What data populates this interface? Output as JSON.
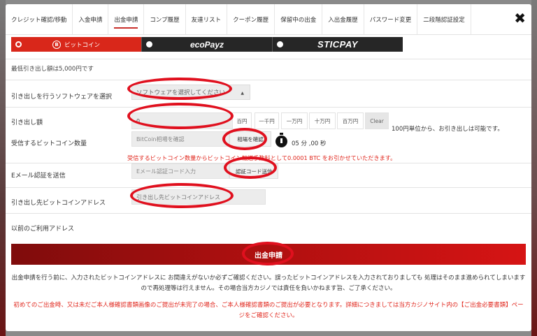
{
  "tabs": [
    {
      "label": "クレジット確認/移動"
    },
    {
      "label": "入金申請"
    },
    {
      "label": "出金申請",
      "active": true
    },
    {
      "label": "コンプ履歴"
    },
    {
      "label": "友達リスト"
    },
    {
      "label": "クーポン履歴"
    },
    {
      "label": "保留中の出金"
    },
    {
      "label": "入出金履歴"
    },
    {
      "label": "パスワード変更"
    },
    {
      "label": "二段階認証設定"
    }
  ],
  "close_icon": "close-icon",
  "payment_methods": [
    {
      "label": "ビットコイン",
      "selected": true,
      "color": "#d9271a"
    },
    {
      "label": "ecoPayz",
      "selected": false,
      "color": "#262626"
    },
    {
      "label": "STICPAY",
      "selected": false,
      "color": "#262626"
    }
  ],
  "min_note": "最低引き出し額は5,000円です",
  "form": {
    "software": {
      "label": "引き出しを行うソフトウェアを選択",
      "placeholder": "ソフトウェアを選択してください"
    },
    "amount": {
      "label": "引き出し額",
      "value": "0",
      "buttons": [
        "百円",
        "一千円",
        "一万円",
        "十万円",
        "百万円"
      ],
      "clear": "Clear",
      "unit_note": "100円単位から、お引き出しは可能です。"
    },
    "btc_amount": {
      "label": "受信するビットコイン数量",
      "placeholder": "BitCoin相場を確認",
      "button": "相場を確認",
      "timer_min": "05",
      "timer_min_unit": "分",
      "timer_sec": ",00",
      "timer_sec_unit": "秒",
      "warning": "受信するビットコイン数量からビットコイン転送手数料として0.0001 BTC をお引かせていただきます。"
    },
    "email": {
      "label": "Eメール認証を送信",
      "placeholder": "Eメール認証コード入力",
      "button": "認証コード送信"
    },
    "address": {
      "label": "引き出し先ビットコインアドレス",
      "placeholder": "引き出し先ビットコインアドレス"
    },
    "previous": {
      "label": "以前のご利用アドレス"
    }
  },
  "submit_label": "出金申請",
  "notice": "出金申請を行う前に、入力されたビットコインアドレスに お間違えがないか必ずご確認ください。誤ったビットコインアドレスを入力されておりましても 処理はそのまま進められてしまいますので再処理等は行えません。その場合当方カジノでは責任を負いかねます旨、ご了承ください。",
  "notice_red": "初めてのご出金時、又は未だご本人様確認書類画像のご提出が未完了の場合、ご本人様確認書類のご提出が必要となります。詳細につきましては当方カジノサイト内の【ご出金必要書類】ページをご確認ください。",
  "colors": {
    "accent_red": "#d9271a",
    "annotation_ring": "#e0101e",
    "warning_text": "#e0261c"
  }
}
